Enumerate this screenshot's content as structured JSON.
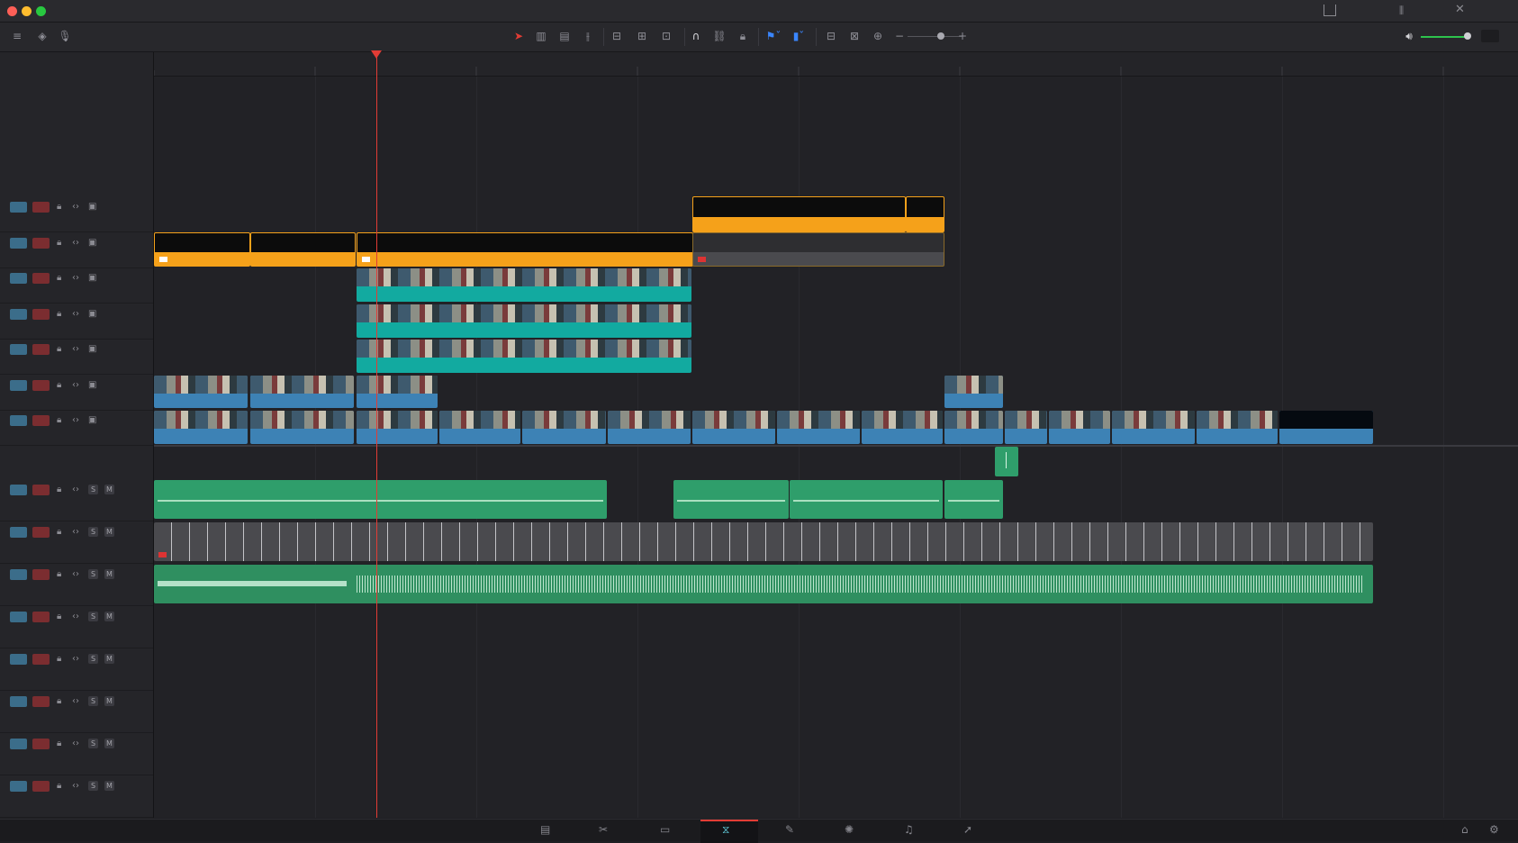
{
  "toolbar": {
    "left_icons": [
      "timeline-view-icon",
      "eye-icon",
      "microphone-icon"
    ],
    "edit_tools": [
      "pointer-icon",
      "trim-icon",
      "dynamic-trim-icon",
      "blade-icon",
      "insert-icon",
      "overwrite-icon",
      "replace-icon",
      "snap-icon",
      "link-icon",
      "lock-icon",
      "flag-icon",
      "marker-icon",
      "zoom-full-icon",
      "zoom-detail-icon",
      "zoom-custom-icon"
    ],
    "zoom_minus": "−",
    "zoom_plus": "+",
    "volume_level": 0.85
  },
  "accent_colors": {
    "playhead": "#e23c35",
    "orange_clip": "#f5a11a",
    "teal_clip": "#12aaa0",
    "blue_clip": "#3d82b5",
    "audio_clip": "#2f9e6b"
  },
  "video_tracks": 7,
  "audio_tracks": 8,
  "audio_track_buttons": {
    "solo": "S",
    "mute": "M"
  },
  "footer": {
    "pages": [
      "media-page-icon",
      "cut-page-icon",
      "edit-page-icon",
      "fusion-page-icon",
      "color-page-icon",
      "fairlight-page-icon",
      "music-page-icon",
      "deliver-page-icon"
    ],
    "active_page": 3
  }
}
